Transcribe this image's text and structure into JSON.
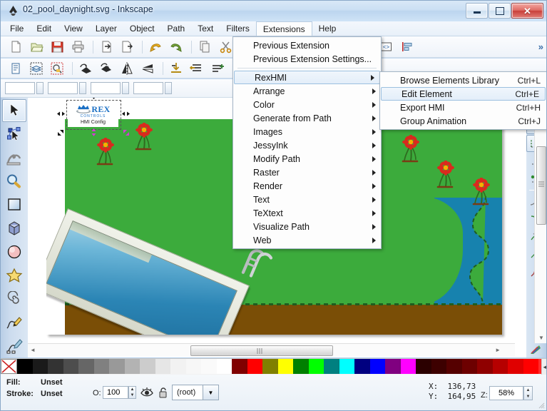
{
  "window": {
    "title": "02_pool_daynight.svg - Inkscape",
    "ghost_text": "",
    "app_icon": "inkscape-icon",
    "buttons": {
      "minimize": "minimize-button",
      "maximize": "maximize-button",
      "close": "✕"
    }
  },
  "menubar": {
    "items": [
      {
        "label": "File",
        "mnemonic": "F"
      },
      {
        "label": "Edit",
        "mnemonic": "E"
      },
      {
        "label": "View",
        "mnemonic": "V"
      },
      {
        "label": "Layer",
        "mnemonic": "L"
      },
      {
        "label": "Object",
        "mnemonic": "O"
      },
      {
        "label": "Path",
        "mnemonic": "P"
      },
      {
        "label": "Text",
        "mnemonic": "T"
      },
      {
        "label": "Filters",
        "mnemonic": "s"
      },
      {
        "label": "Extensions",
        "mnemonic": "n",
        "open": true
      },
      {
        "label": "Help",
        "mnemonic": "H"
      }
    ]
  },
  "extensions_menu": {
    "items": [
      {
        "label": "Previous Extension",
        "submenu": false,
        "accel": ""
      },
      {
        "label": "Previous Extension Settings...",
        "submenu": false,
        "accel": ""
      },
      {
        "separator": true
      },
      {
        "label": "RexHMI",
        "submenu": true,
        "highlighted": true,
        "accel": ""
      },
      {
        "label": "Arrange",
        "submenu": true,
        "accel": ""
      },
      {
        "label": "Color",
        "submenu": true,
        "accel": ""
      },
      {
        "label": "Generate from Path",
        "submenu": true,
        "accel": ""
      },
      {
        "label": "Images",
        "submenu": true,
        "accel": ""
      },
      {
        "label": "JessyInk",
        "submenu": true,
        "accel": ""
      },
      {
        "label": "Modify Path",
        "submenu": true,
        "accel": ""
      },
      {
        "label": "Raster",
        "submenu": true,
        "accel": ""
      },
      {
        "label": "Render",
        "submenu": true,
        "accel": ""
      },
      {
        "label": "Text",
        "submenu": true,
        "accel": ""
      },
      {
        "label": "TeXtext",
        "submenu": true,
        "accel": ""
      },
      {
        "label": "Visualize Path",
        "submenu": true,
        "accel": ""
      },
      {
        "label": "Web",
        "submenu": true,
        "accel": ""
      }
    ]
  },
  "rexhmi_submenu": {
    "items": [
      {
        "label": "Browse Elements Library",
        "accel": "Ctrl+L",
        "highlighted": false
      },
      {
        "label": "Edit Element",
        "accel": "Ctrl+E",
        "highlighted": true
      },
      {
        "label": "Export HMI",
        "accel": "Ctrl+H",
        "highlighted": false
      },
      {
        "label": "Group Animation",
        "accel": "Ctrl+J",
        "highlighted": false
      }
    ]
  },
  "command_toolbar": {
    "buttons": [
      {
        "name": "new-document-icon"
      },
      {
        "name": "open-document-icon"
      },
      {
        "name": "save-document-icon"
      },
      {
        "name": "print-document-icon"
      },
      {
        "separator": true
      },
      {
        "name": "import-icon"
      },
      {
        "name": "export-icon"
      },
      {
        "separator": true
      },
      {
        "name": "undo-icon"
      },
      {
        "name": "redo-icon"
      },
      {
        "separator": true
      },
      {
        "name": "copy-icon"
      },
      {
        "name": "cut-icon"
      },
      {
        "name": "paste-icon"
      },
      {
        "separator": true
      },
      {
        "name": "zoom-selection-icon"
      },
      {
        "name": "zoom-drawing-icon"
      },
      {
        "separator": true
      },
      {
        "name": "fill-stroke-dialog-icon"
      },
      {
        "name": "text-properties-icon"
      },
      {
        "name": "layers-dialog-icon"
      },
      {
        "name": "xml-editor-icon"
      },
      {
        "name": "align-dialog-icon"
      }
    ],
    "overflow_label": "»"
  },
  "snap_toolbar_right": {
    "buttons": [
      "enable-snapping-icon",
      "snap-bounding-box-icon",
      "snap-bbox-edge-icon",
      "snap-bbox-corner-icon",
      "snap-nodes-icon",
      "snap-node-path-icon",
      "snap-node-cusp-icon",
      "snap-node-smooth-icon",
      "snap-midpoint-icon",
      "snap-object-center-icon"
    ]
  },
  "toolbox": {
    "tools": [
      {
        "name": "selector-tool",
        "icon": "arrow-icon",
        "active": true
      },
      {
        "name": "node-tool",
        "icon": "node-editor-icon",
        "active": false
      },
      {
        "name": "tweak-tool",
        "icon": "tweak-icon",
        "active": false
      },
      {
        "name": "zoom-tool",
        "icon": "magnifier-icon",
        "active": false
      },
      {
        "name": "rectangle-tool",
        "icon": "square-icon",
        "active": false
      },
      {
        "name": "3dbox-tool",
        "icon": "cube-icon",
        "active": false
      },
      {
        "name": "ellipse-tool",
        "icon": "circle-icon",
        "active": false
      },
      {
        "name": "star-tool",
        "icon": "star-icon",
        "active": false
      },
      {
        "name": "spiral-tool",
        "icon": "spiral-icon",
        "active": false
      },
      {
        "name": "pencil-tool",
        "icon": "pencil-icon",
        "active": false
      },
      {
        "name": "pen-tool",
        "icon": "bezier-pen-icon",
        "active": false
      }
    ]
  },
  "canvas": {
    "document_name": "02_pool_daynight.svg",
    "selected_object": {
      "logo_title": "REX",
      "logo_subtitle": "CONTROLS",
      "logo_caption": "HMI Config"
    },
    "scene": {
      "grass_color": "#3cab3c",
      "dirt_color": "#7a4e06",
      "water_color": "#1782ae",
      "pool_water_color": "#2b85b5",
      "pool_rim_color": "#e7eadd",
      "flower_petal_color": "#d92a1e",
      "flower_center_color": "#f5b000"
    }
  },
  "palette": {
    "none_swatch_label": "none",
    "left_arrow": "◄",
    "right_arrow": "►",
    "colors": [
      "#000000",
      "#1a1a1a",
      "#333333",
      "#4d4d4d",
      "#666666",
      "#808080",
      "#999999",
      "#b3b3b3",
      "#cccccc",
      "#e6e6e6",
      "#f2f2f2",
      "#f7f7f7",
      "#fafafa",
      "#ffffff",
      "#800000",
      "#ff0000",
      "#808000",
      "#ffff00",
      "#008000",
      "#00ff00",
      "#008080",
      "#00ffff",
      "#000080",
      "#0000ff",
      "#800080",
      "#ff00ff",
      "#2b0000",
      "#3d0000",
      "#550000",
      "#6d0000",
      "#8f0000",
      "#b60000",
      "#e00000",
      "#ff0000",
      "#ff2b2b",
      "#ff5555",
      "#ff8080",
      "#ffaaaa",
      "#ffd5d5",
      "#2b1414",
      "#3d1c1c",
      "#552727",
      "#6d3232",
      "#8f4242",
      "#b65555",
      "#c46363"
    ]
  },
  "statusbar": {
    "fill_label": "Fill:",
    "fill_value": "Unset",
    "stroke_label": "Stroke:",
    "stroke_value": "Unset",
    "opacity_label": "O:",
    "opacity_value": "100",
    "layer_name": "(root)",
    "layer_visibility_icon": "eye-icon",
    "layer_lock_icon": "unlock-icon",
    "x_label": "X:",
    "x_value": "136,73",
    "y_label": "Y:",
    "y_value": "164,95",
    "zoom_label": "Z:",
    "zoom_value": "58%"
  }
}
